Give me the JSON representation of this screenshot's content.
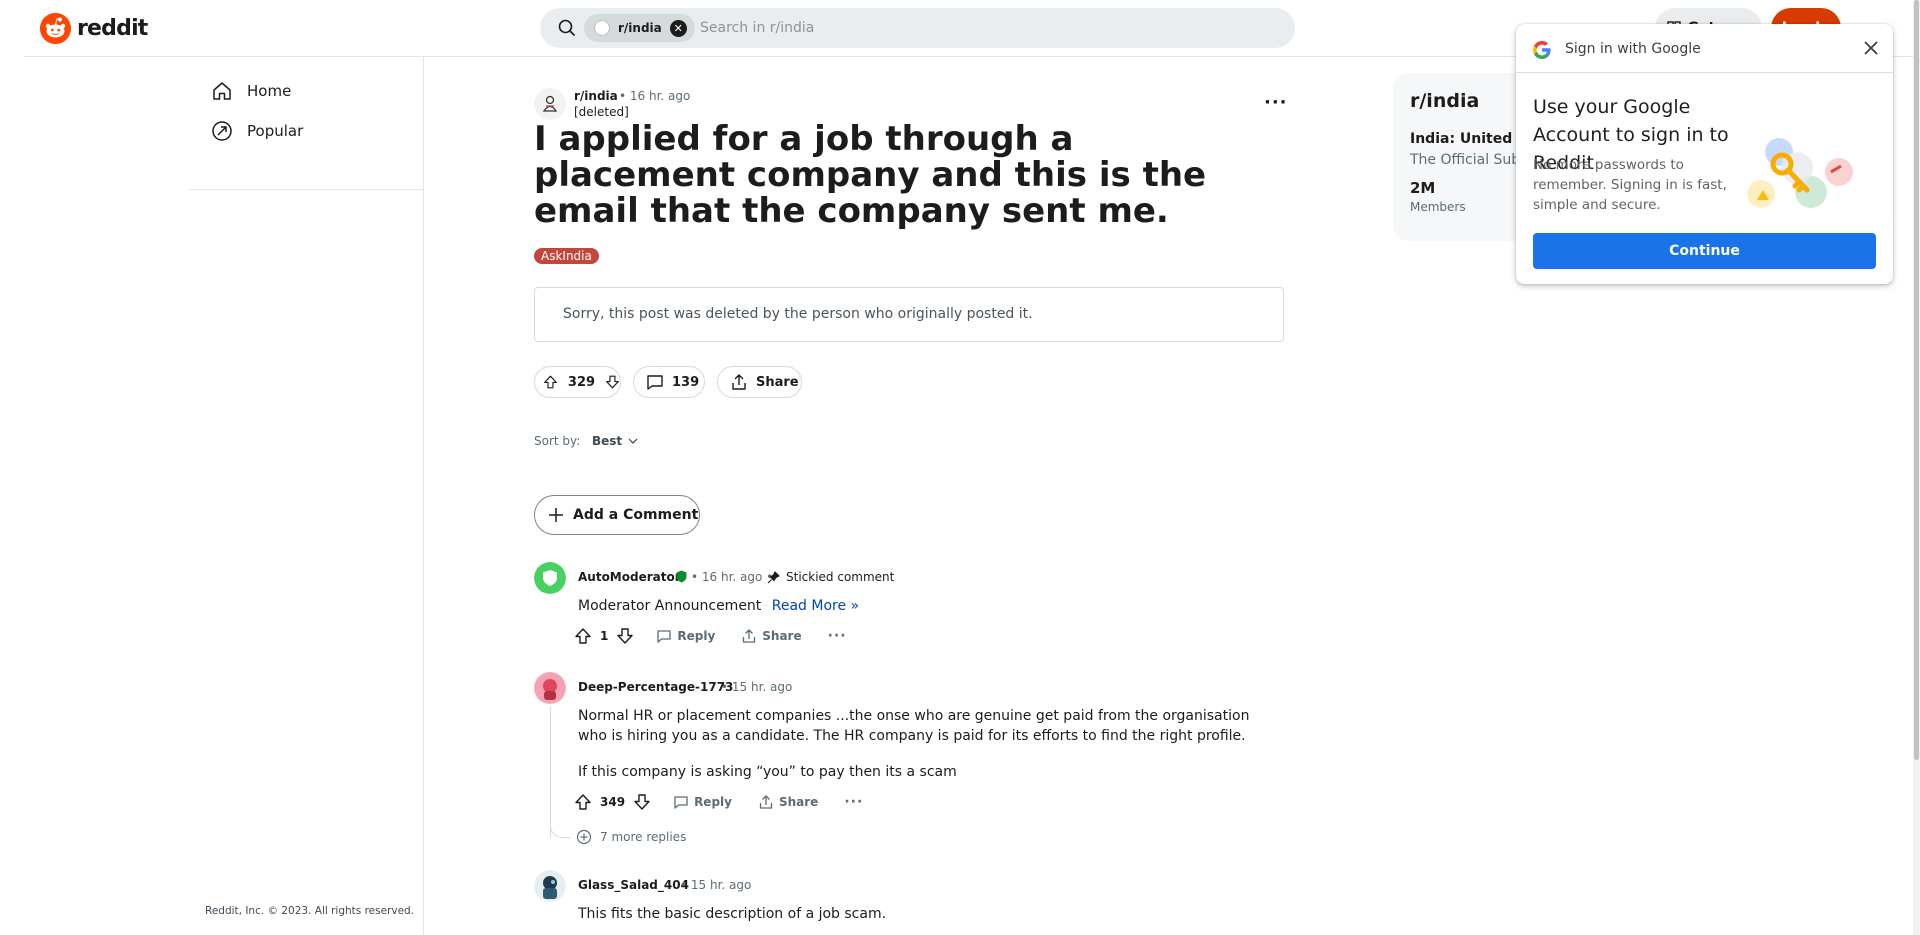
{
  "header": {
    "logo_text": "reddit",
    "search_chip": "r/india",
    "search_placeholder": "Search in r/india",
    "get_app": "Get app",
    "login": "Log In",
    "brand_color": "#ff4500"
  },
  "sidebar": {
    "items": [
      {
        "label": "Home",
        "icon": "home-icon"
      },
      {
        "label": "Popular",
        "icon": "popular-icon"
      }
    ],
    "footer": "Reddit, Inc. © 2023. All rights reserved."
  },
  "post": {
    "subreddit": "r/india",
    "time": "• 16 hr. ago",
    "author": "[deleted]",
    "title": "I applied for a job through a placement company and this is the email that the company sent me.",
    "flair": "AskIndia",
    "deleted_message": "Sorry, this post was deleted by the person who originally posted it.",
    "votes": "329",
    "comments": "139",
    "share": "Share",
    "sort_label": "Sort by:",
    "sort_value": "Best",
    "add_comment": "Add a Comment"
  },
  "comments": [
    {
      "user": "AutoModerator",
      "time": "• 16 hr. ago •",
      "tag": "Stickied comment",
      "body": "Moderator Announcement",
      "link": "Read More »",
      "votes": "1",
      "reply": "Reply",
      "share": "Share"
    },
    {
      "user": "Deep-Percentage-1773",
      "time": "• 15 hr. ago",
      "body": "Normal HR or placement companies ...the onse who are genuine get paid from the organisation who is hiring you as a candidate. The HR company is paid for its efforts to find the right profile.",
      "body2": "If this company is asking “you” to pay then its a scam",
      "votes": "349",
      "reply": "Reply",
      "share": "Share",
      "more_replies": "7 more replies"
    },
    {
      "user": "Glass_Salad_404",
      "time": "• 15 hr. ago",
      "body": "This fits the basic description of a job scam."
    }
  ],
  "community": {
    "name": "r/india",
    "title": "India: United W",
    "description": "The Official Subr",
    "members_count": "2M",
    "members_label": "Members"
  },
  "google_popup": {
    "header": "Sign in with Google",
    "title": "Use your Google Account to sign in to Reddit",
    "text": "No more passwords to remember. Signing in is fast, simple and secure.",
    "button": "Continue",
    "button_color": "#1a73e8"
  }
}
